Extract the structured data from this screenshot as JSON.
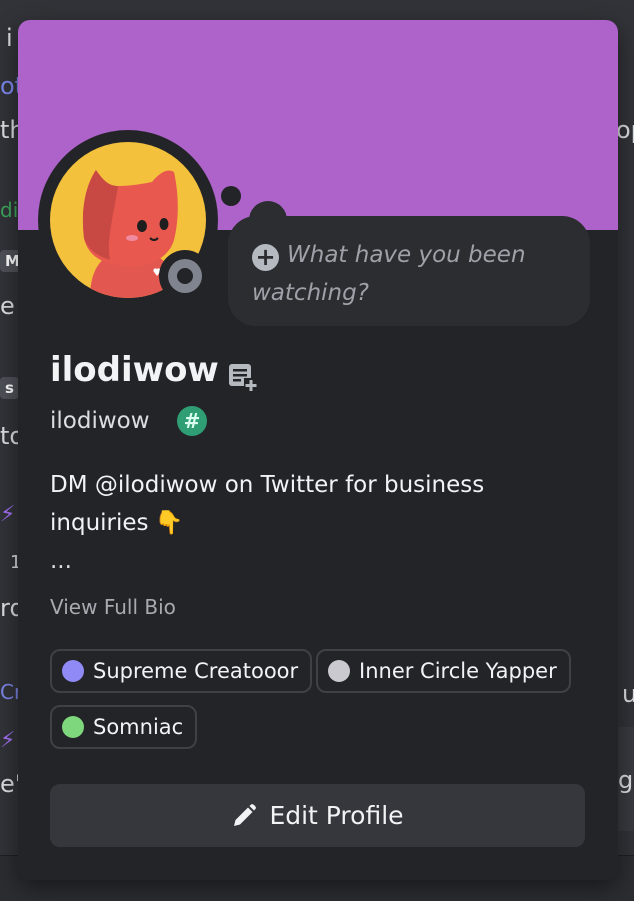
{
  "background": {
    "fragments": [
      "i",
      "oto",
      "th",
      "op",
      "di",
      "M",
      "e",
      "s",
      "to",
      "1",
      "rd",
      "Cr",
      "ui",
      "e's",
      "g"
    ]
  },
  "profile": {
    "banner_color": "#ad63c9",
    "status_thought_placeholder": "What have you been watching?",
    "display_name": "ilodiwow",
    "username": "ilodiwow",
    "badge_symbol": "#",
    "bio": "DM @ilodiwow on Twitter for business inquiries",
    "bio_emoji": "👇",
    "bio_ellipsis": "...",
    "view_full_bio": "View Full Bio",
    "roles": [
      {
        "label": "Supreme Creatooor",
        "color": "#8f8af5"
      },
      {
        "label": "Inner Circle Yapper",
        "color": "#c9c9cf"
      },
      {
        "label": "Somniac",
        "color": "#7ed77c"
      }
    ],
    "edit_profile_label": "Edit Profile"
  },
  "icons": {
    "add_note": "note-add-icon",
    "edit": "pencil-icon",
    "status": "status-idle-icon",
    "add_status": "plus-circle-icon"
  }
}
